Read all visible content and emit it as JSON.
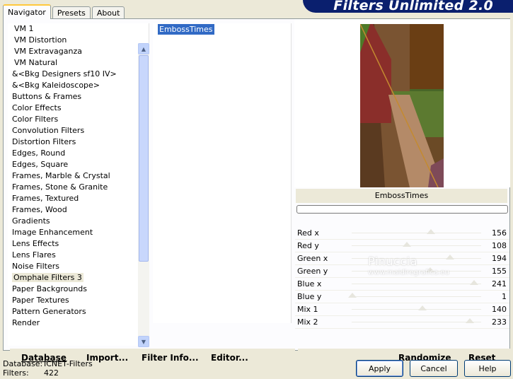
{
  "tabs": [
    {
      "label": "Navigator",
      "active": true
    },
    {
      "label": "Presets",
      "active": false
    },
    {
      "label": "About",
      "active": false
    }
  ],
  "banner": {
    "title": "Filters Unlimited 2.0"
  },
  "categories": [
    {
      "label": "VM 1",
      "indent": true
    },
    {
      "label": "VM Distortion",
      "indent": true
    },
    {
      "label": "VM Extravaganza",
      "indent": true
    },
    {
      "label": "VM Natural",
      "indent": true
    },
    {
      "label": "&<Bkg Designers sf10 IV>",
      "indent": false
    },
    {
      "label": "&<Bkg Kaleidoscope>",
      "indent": false
    },
    {
      "label": "Buttons & Frames",
      "indent": false
    },
    {
      "label": "Color Effects",
      "indent": false
    },
    {
      "label": "Color Filters",
      "indent": false
    },
    {
      "label": "Convolution Filters",
      "indent": false
    },
    {
      "label": "Distortion Filters",
      "indent": false
    },
    {
      "label": "Edges, Round",
      "indent": false
    },
    {
      "label": "Edges, Square",
      "indent": false
    },
    {
      "label": "Frames, Marble & Crystal",
      "indent": false
    },
    {
      "label": "Frames, Stone & Granite",
      "indent": false
    },
    {
      "label": "Frames, Textured",
      "indent": false
    },
    {
      "label": "Frames, Wood",
      "indent": false
    },
    {
      "label": "Gradients",
      "indent": false
    },
    {
      "label": "Image Enhancement",
      "indent": false
    },
    {
      "label": "Lens Effects",
      "indent": false
    },
    {
      "label": "Lens Flares",
      "indent": false
    },
    {
      "label": "Noise Filters",
      "indent": false
    },
    {
      "label": "Omphale Filters 3",
      "indent": false,
      "selected": true
    },
    {
      "label": "Paper Backgrounds",
      "indent": false
    },
    {
      "label": "Paper Textures",
      "indent": false
    },
    {
      "label": "Pattern Generators",
      "indent": false
    },
    {
      "label": "Render",
      "indent": false
    }
  ],
  "filters": [
    "EmbossTimes"
  ],
  "preview": {
    "filter_name": "EmbossTimes"
  },
  "sliders": [
    {
      "label": "Red x",
      "value": 156,
      "knob": 156
    },
    {
      "label": "Red y",
      "value": 108,
      "knob": 108
    },
    {
      "label": "Green x",
      "value": 194,
      "knob": 194
    },
    {
      "label": "Green y",
      "value": 155,
      "knob": 155
    },
    {
      "label": "Blue x",
      "value": 241,
      "knob": 241
    },
    {
      "label": "Blue y",
      "value": 1,
      "knob": 1
    },
    {
      "label": "Mix 1",
      "value": 140,
      "knob": 140
    },
    {
      "label": "Mix 2",
      "value": 233,
      "knob": 233
    }
  ],
  "watermark": {
    "name": "Pinuccia",
    "site": "www.maidiregrafica.eu"
  },
  "toolbar": {
    "database": "Database",
    "import": "Import...",
    "filter_info": "Filter Info...",
    "editor": "Editor...",
    "randomize": "Randomize",
    "reset": "Reset"
  },
  "status": {
    "database_label": "Database:",
    "database_value": "ICNET-Filters",
    "filters_label": "Filters:",
    "filters_value": "422"
  },
  "buttons": {
    "apply": "Apply",
    "cancel": "Cancel",
    "help": "Help"
  }
}
